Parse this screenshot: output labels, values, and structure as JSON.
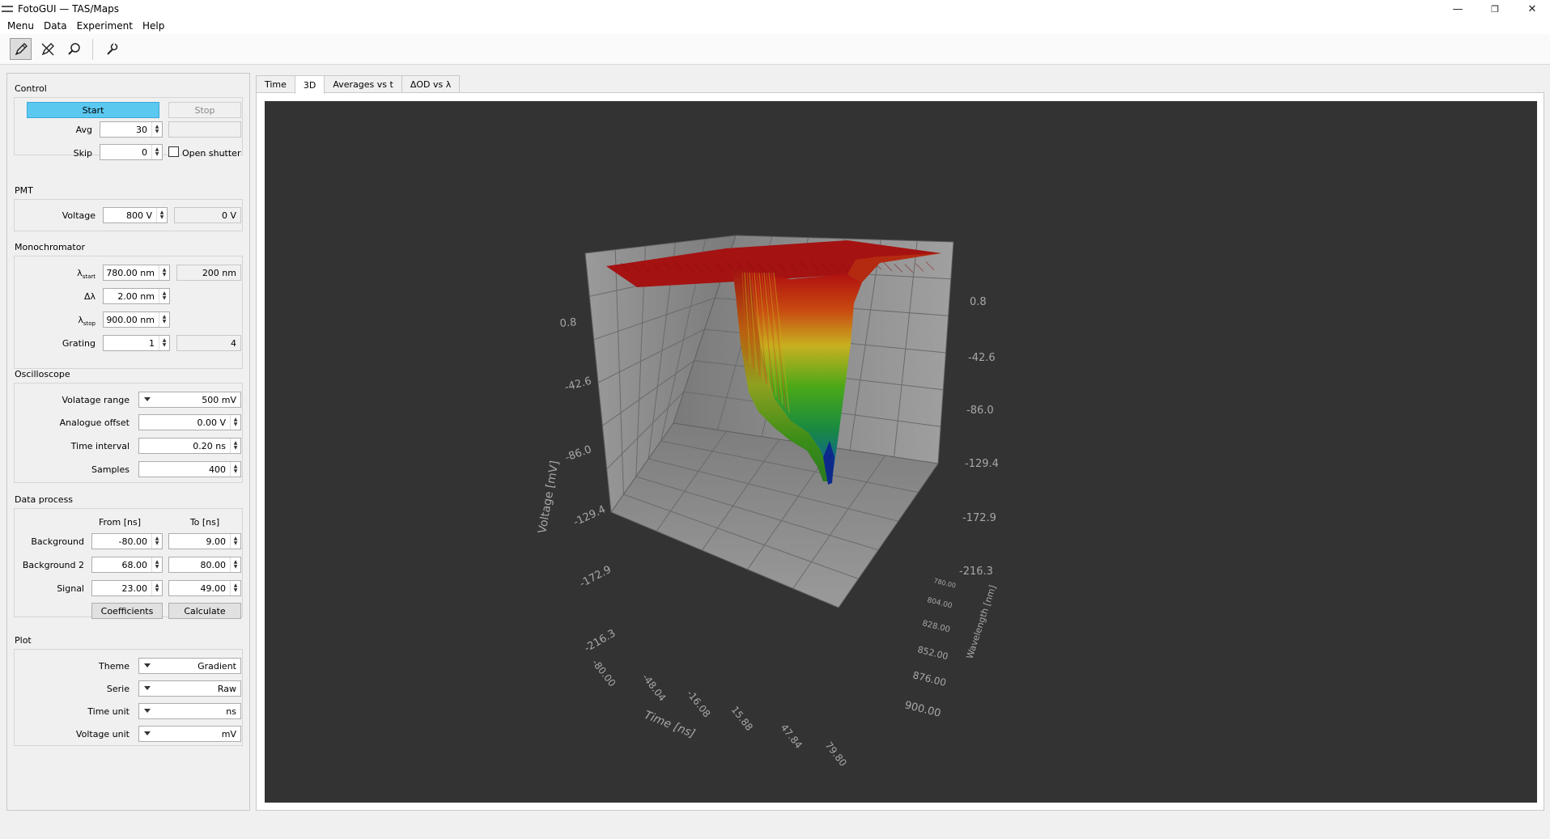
{
  "window": {
    "title": "FotoGUI — TAS/Maps",
    "controls": {
      "minimize": "—",
      "restore": "❐",
      "close": "✕"
    }
  },
  "menu": [
    "Menu",
    "Data",
    "Experiment",
    "Help"
  ],
  "toolbar": [
    {
      "icon": "pen-icon",
      "active": true
    },
    {
      "icon": "pen-slash-icon",
      "active": false
    },
    {
      "icon": "magnifier-icon",
      "active": false
    },
    {
      "icon": "wrench-icon",
      "active": false
    }
  ],
  "control": {
    "title": "Control",
    "start_label": "Start",
    "stop_label": "Stop",
    "avg_label": "Avg",
    "avg_value": "30",
    "avg_readout": "",
    "skip_label": "Skip",
    "skip_value": "0",
    "open_shutter_label": "Open shutter"
  },
  "pmt": {
    "title": "PMT",
    "voltage_label": "Voltage",
    "voltage_value": "800 V",
    "voltage_readout": "0 V"
  },
  "monochromator": {
    "title": "Monochromator",
    "lambda_start_main": "λ",
    "lambda_start_sub": "start",
    "lambda_start_value": "780.00 nm",
    "lambda_readout": "200 nm",
    "dlambda_label": "Δλ",
    "dlambda_value": "2.00 nm",
    "lambda_stop_main": "λ",
    "lambda_stop_sub": "stop",
    "lambda_stop_value": "900.00 nm",
    "grating_label": "Grating",
    "grating_value": "1",
    "grating_readout": "4"
  },
  "oscilloscope": {
    "title": "Oscilloscope",
    "range_label": "Volatage range",
    "range_value": "500 mV",
    "offset_label": "Analogue offset",
    "offset_value": "0.00 V",
    "interval_label": "Time interval",
    "interval_value": "0.20 ns",
    "samples_label": "Samples",
    "samples_value": "400"
  },
  "data_process": {
    "title": "Data process",
    "from_header": "From [ns]",
    "to_header": "To [ns]",
    "rows": [
      {
        "label": "Background",
        "from": "-80.00",
        "to": "9.00"
      },
      {
        "label": "Background 2",
        "from": "68.00",
        "to": "80.00"
      },
      {
        "label": "Signal",
        "from": "23.00",
        "to": "49.00"
      }
    ],
    "coefficients_label": "Coefficients",
    "calculate_label": "Calculate"
  },
  "plot_settings": {
    "title": "Plot",
    "theme_label": "Theme",
    "theme_value": "Gradient",
    "serie_label": "Serie",
    "serie_value": "Raw",
    "time_unit_label": "Time unit",
    "time_unit_value": "ns",
    "voltage_unit_label": "Voltage unit",
    "voltage_unit_value": "mV"
  },
  "tabs": [
    {
      "label": "Time",
      "active": false
    },
    {
      "label": "3D",
      "active": true
    },
    {
      "label": "Averages vs t",
      "active": false
    },
    {
      "label": "ΔOD vs λ",
      "active": false
    }
  ],
  "colors": {
    "start_button": "#5bc8f0",
    "plot_background": "#333333",
    "floor": "#8a8a8a",
    "surface_high": "#b01010",
    "surface_mid": "#2f9a1a",
    "surface_low": "#0a2a9a"
  },
  "chart_data": {
    "type": "surface3d",
    "xlabel": "Time [ns]",
    "ylabel": "Voltage [mV]",
    "zlabel": "Wavelength [nm]",
    "x_ticks": [
      "-80.00",
      "-48.04",
      "-16.08",
      "15.88",
      "47.84",
      "79.80"
    ],
    "y_ticks": [
      "0.8",
      "-42.6",
      "-86.0",
      "-129.4",
      "-172.9",
      "-216.3"
    ],
    "y_ticks_right": [
      "0.8",
      "-42.6",
      "-86.0",
      "-129.4",
      "-172.9",
      "-216.3"
    ],
    "z_ticks": [
      "780.00",
      "804.00",
      "828.00",
      "852.00",
      "876.00",
      "900.00"
    ],
    "xlim": [
      -80.0,
      79.8
    ],
    "ylim": [
      -216.3,
      0.8
    ],
    "zlim": [
      780.0,
      900.0
    ],
    "baseline_mV": 0.8,
    "min_mV": -216.3,
    "min_at_time_ns": 38,
    "grid": true
  }
}
